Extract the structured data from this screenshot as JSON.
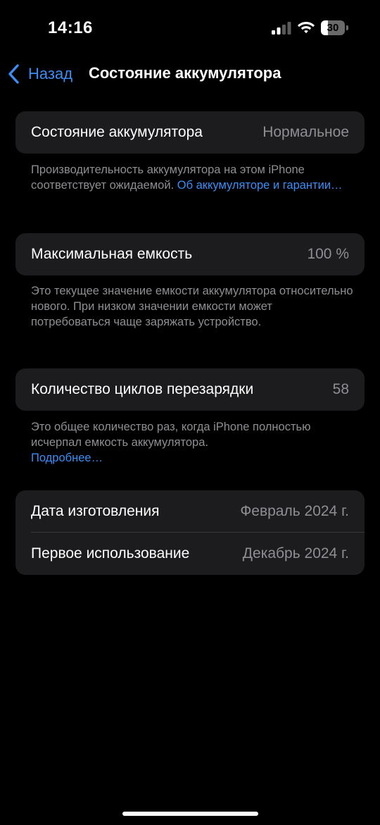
{
  "status_bar": {
    "time": "14:16",
    "battery_percent": "30",
    "battery_level": 0.3,
    "icons": [
      "signal-icon",
      "wifi-icon",
      "battery-icon"
    ]
  },
  "nav": {
    "back_label": "Назад",
    "title": "Состояние аккумулятора"
  },
  "health": {
    "label": "Состояние аккумулятора",
    "value": "Нормальное",
    "footnote_text": "Производительность аккумулятора на этом iPhone соответствует ожидаемой. ",
    "footnote_link": "Об аккумуляторе и гарантии…"
  },
  "capacity": {
    "label": "Максимальная емкость",
    "value": "100 %",
    "footnote_text": "Это текущее значение емкости аккумулятора относительно нового. При низком значении емкости может потребоваться чаще заряжать устройство."
  },
  "cycles": {
    "label": "Количество циклов перезарядки",
    "value": "58",
    "footnote_text": "Это общее количество раз, когда iPhone полностью исчерпал емкость аккумулятора.",
    "footnote_link": "Подробнее…"
  },
  "dates": {
    "manufacture_label": "Дата изготовления",
    "manufacture_value": "Февраль 2024 г.",
    "first_use_label": "Первое использование",
    "first_use_value": "Декабрь 2024 г."
  },
  "colors": {
    "background": "#000000",
    "card": "#1c1c1e",
    "accent": "#3a8ef6",
    "secondary_text": "#8e8e93"
  }
}
